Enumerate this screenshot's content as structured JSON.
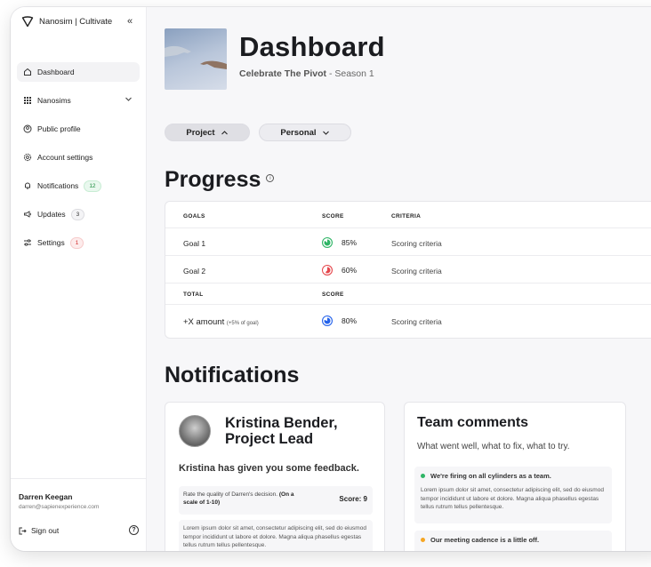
{
  "brand": {
    "name": "Nanosim | Cultivate",
    "collapse_glyph": "«"
  },
  "sidebar": {
    "items": [
      {
        "label": "Dashboard",
        "icon": "home-icon",
        "glyph": "⌂"
      },
      {
        "label": "Nanosims",
        "icon": "grid-icon",
        "glyph": "▦"
      },
      {
        "label": "Public profile",
        "icon": "profile-icon",
        "glyph": "◉"
      },
      {
        "label": "Account settings",
        "icon": "gear-icon",
        "glyph": "⚙"
      },
      {
        "label": "Notifications",
        "icon": "bell-icon",
        "glyph": "🔔",
        "badge": "12"
      },
      {
        "label": "Updates",
        "icon": "megaphone-icon",
        "glyph": "📣",
        "badge": "3"
      },
      {
        "label": "Settings",
        "icon": "sliders-icon",
        "glyph": "⚟",
        "badge": "1"
      }
    ],
    "user": {
      "name": "Darren Keegan",
      "email": "darren@sapienexperience.com"
    },
    "sign_out": "Sign out",
    "help_glyph": "?"
  },
  "header": {
    "title": "Dashboard",
    "subtitle_bold": "Celebrate The Pivot",
    "subtitle_rest": " - Season 1"
  },
  "filters": {
    "project": "Project",
    "personal": "Personal"
  },
  "progress": {
    "title": "Progress",
    "info_glyph": "i",
    "headers": {
      "goals": "GOALS",
      "score": "SCORE",
      "criteria": "CRITERIA",
      "total": "TOTAL",
      "total_score": "SCORE"
    },
    "rows": [
      {
        "goal": "Goal 1",
        "score": "85%",
        "criteria": "Scoring criteria",
        "value": 85,
        "color": "#2fb566"
      },
      {
        "goal": "Goal 2",
        "score": "60%",
        "criteria": "Scoring criteria",
        "value": 60,
        "color": "#e5484d"
      }
    ],
    "total_row": {
      "label": "+X amount",
      "note": "(+5% of goal)",
      "score": "80%",
      "criteria": "Scoring criteria",
      "value": 80,
      "color": "#2563eb"
    }
  },
  "notifications": {
    "title": "Notifications",
    "feedback_card": {
      "name": "Kristina Bender, Project Lead",
      "line1": "Kristina Bender,",
      "line2": "Project Lead",
      "subtitle": "Kristina has given you some feedback.",
      "rate_question": "Rate the quality of Darren's decision.",
      "rate_scale": "(On a scale of 1-10)",
      "score": "Score: 9",
      "body": "Lorem ipsum dolor sit amet, consectetur adipiscing elit, sed do eiusmod tempor incididunt ut labore et dolore. Magna aliqua phasellus egestas tellus rutrum tellus pellentesque."
    },
    "team_card": {
      "title": "Team comments",
      "subtitle": "What went well, what to fix, what to try.",
      "comments": [
        {
          "head": "We're firing on all cylinders as a team.",
          "dot_color": "#2fb566",
          "body": "Lorem ipsum dolor sit amet, consectetur adipiscing elit, sed do eiusmod tempor incididunt ut labore et dolore. Magna aliqua phasellus egestas tellus rutrum tellus pellentesque."
        },
        {
          "head": "Our meeting cadence is a little off.",
          "dot_color": "#f5a623",
          "body": ""
        }
      ]
    }
  }
}
